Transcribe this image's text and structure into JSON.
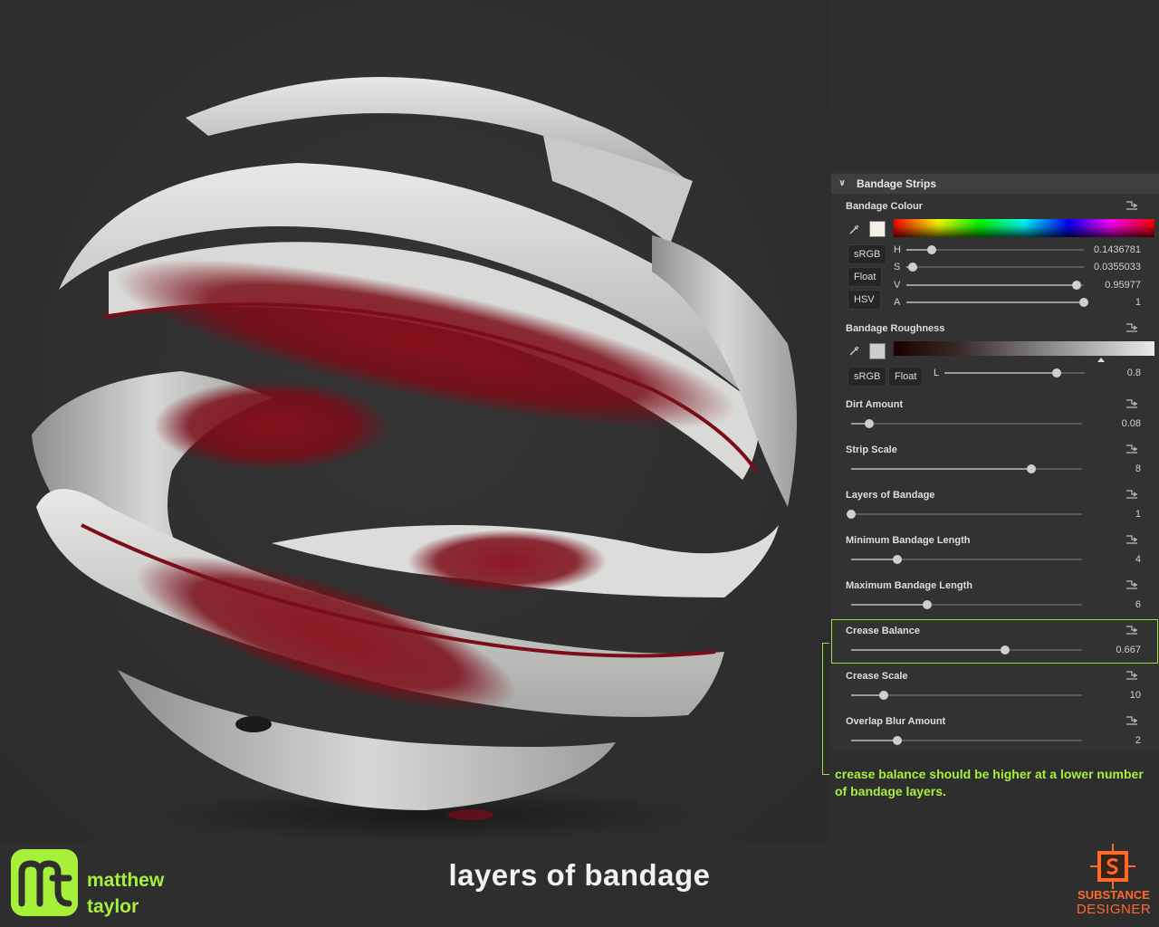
{
  "panel": {
    "section_title": "Bandage Strips",
    "colour": {
      "label": "Bandage Colour",
      "buttons": [
        "sRGB",
        "Float",
        "HSV"
      ],
      "channels": [
        {
          "name": "H",
          "value": "0.1436781",
          "level": 0.1436781
        },
        {
          "name": "S",
          "value": "0.0355033",
          "level": 0.0355033
        },
        {
          "name": "V",
          "value": "0.95977",
          "level": 0.95977
        },
        {
          "name": "A",
          "value": "1",
          "level": 1
        }
      ],
      "swatch_color": "#f3efe6"
    },
    "roughness": {
      "label": "Bandage Roughness",
      "buttons": [
        "sRGB",
        "Float"
      ],
      "channel": {
        "name": "L",
        "value": "0.8",
        "level": 0.8
      },
      "swatch_color": "#cccccc"
    },
    "sliders": [
      {
        "label": "Dirt Amount",
        "value": "0.08",
        "level": 0.08
      },
      {
        "label": "Strip Scale",
        "value": "8",
        "level": 0.78
      },
      {
        "label": "Layers of Bandage",
        "value": "1",
        "level": 0.0
      },
      {
        "label": "Minimum Bandage Length",
        "value": "4",
        "level": 0.2
      },
      {
        "label": "Maximum Bandage Length",
        "value": "6",
        "level": 0.33
      },
      {
        "label": "Crease Balance",
        "value": "0.667",
        "level": 0.667
      },
      {
        "label": "Crease Scale",
        "value": "10",
        "level": 0.14
      },
      {
        "label": "Overlap Blur Amount",
        "value": "2",
        "level": 0.2
      }
    ]
  },
  "annotation": {
    "callout_text": "crease balance should be higher at a lower number of bandage layers.",
    "highlight_color": "#9be23f"
  },
  "footer": {
    "author_first": "matthew",
    "author_last": "taylor",
    "title": "layers of bandage",
    "brand_line1": "SUBSTANCE",
    "brand_line2": "DESIGNER",
    "accent_color": "#a6f03c",
    "brand_color": "#ff6a2a"
  }
}
